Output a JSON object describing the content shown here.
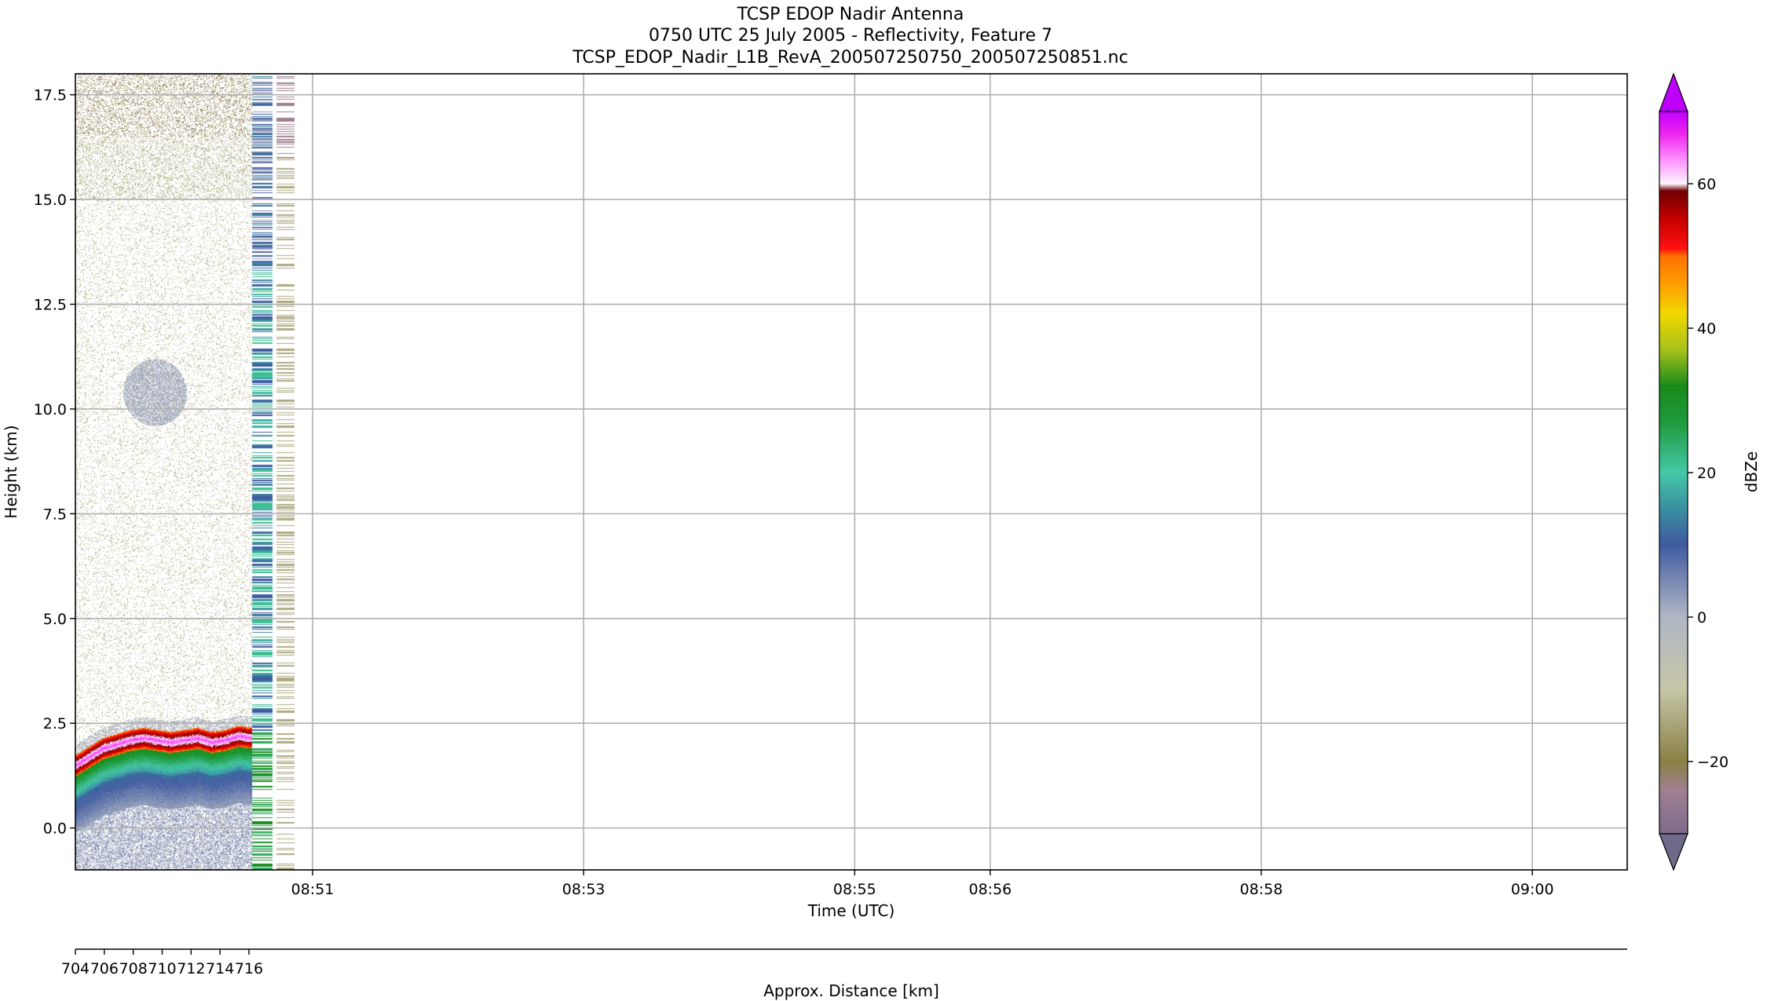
{
  "titles": [
    "TCSP EDOP Nadir Antenna",
    "0750 UTC 25 July 2005 - Reflectivity, Feature 7",
    "TCSP_EDOP_Nadir_L1B_RevA_200507250750_200507250851.nc"
  ],
  "chart_data": {
    "type": "heatmap",
    "xlabel": "Time (UTC)",
    "ylabel": "Height (km)",
    "ylim": [
      -1.0,
      18.0
    ],
    "xlim": [
      "08:49:15",
      "09:00:42"
    ],
    "grid": true,
    "x_ticks": [
      {
        "time": "08:51:00",
        "label": "08:51"
      },
      {
        "time": "08:53:00",
        "label": "08:53"
      },
      {
        "time": "08:55:00",
        "label": "08:55"
      },
      {
        "time": "08:56:00",
        "label": "08:56"
      },
      {
        "time": "08:58:00",
        "label": "08:58"
      },
      {
        "time": "09:00:00",
        "label": "09:00"
      }
    ],
    "y_ticks": [
      0.0,
      2.5,
      5.0,
      7.5,
      10.0,
      12.5,
      15.0,
      17.5
    ],
    "y_tick_labels": [
      "0.0",
      "2.5",
      "5.0",
      "7.5",
      "10.0",
      "12.5",
      "15.0",
      "17.5"
    ],
    "data_end_time": "08:50:52",
    "bright_band_height_km": [
      1.5,
      1.7,
      1.9,
      2.0,
      2.1,
      2.15,
      2.1,
      2.05,
      2.1,
      2.15,
      2.05,
      2.1,
      2.2,
      2.15
    ],
    "colorbar": {
      "label": "dBZe",
      "range": [
        -30,
        70
      ],
      "extend": "both",
      "ticks": [
        -20,
        0,
        20,
        40,
        60
      ],
      "tick_labels": [
        "−20",
        "0",
        "20",
        "40",
        "60"
      ],
      "stops": [
        {
          "value": -30,
          "color": "#7e6a8e"
        },
        {
          "value": -24,
          "color": "#a08090"
        },
        {
          "value": -20,
          "color": "#8a8044"
        },
        {
          "value": -10,
          "color": "#c6c6a8"
        },
        {
          "value": 0,
          "color": "#b0b6c4"
        },
        {
          "value": 10,
          "color": "#3f5aa0"
        },
        {
          "value": 15,
          "color": "#3a8fa0"
        },
        {
          "value": 20,
          "color": "#45c8a8"
        },
        {
          "value": 27,
          "color": "#1f9a3c"
        },
        {
          "value": 32,
          "color": "#1a8a1a"
        },
        {
          "value": 37,
          "color": "#a6c21a"
        },
        {
          "value": 42,
          "color": "#f0d800"
        },
        {
          "value": 46,
          "color": "#ffa000"
        },
        {
          "value": 50,
          "color": "#ff7000"
        },
        {
          "value": 51,
          "color": "#ff1010"
        },
        {
          "value": 55,
          "color": "#c80000"
        },
        {
          "value": 59,
          "color": "#700000"
        },
        {
          "value": 60,
          "color": "#fff4ff"
        },
        {
          "value": 63,
          "color": "#ff9aff"
        },
        {
          "value": 67,
          "color": "#ee22ee"
        },
        {
          "value": 70,
          "color": "#c000ff"
        }
      ],
      "under_color": "#6f6a8a",
      "over_color": "#c000ff"
    },
    "secondary_axis": {
      "label": "Approx. Distance [km]",
      "ticks": [
        704,
        706,
        708,
        710,
        712,
        714,
        716
      ],
      "tick_labels": [
        "704",
        "706",
        "708",
        "710",
        "712",
        "714",
        "716"
      ],
      "range": [
        704,
        716
      ]
    }
  }
}
